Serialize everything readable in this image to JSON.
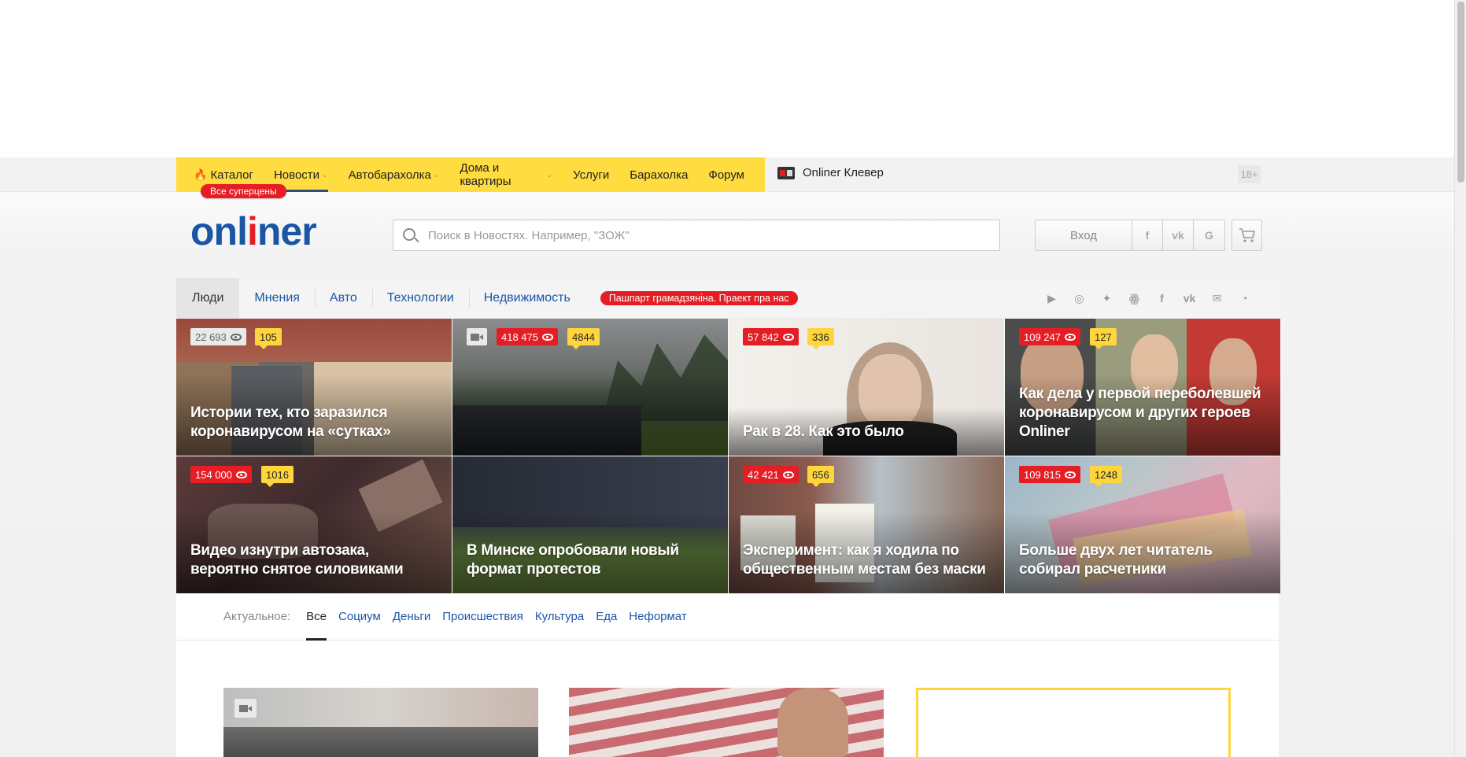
{
  "topnav": {
    "items": [
      {
        "label": "Каталог",
        "icon": "fire-icon",
        "caret": false,
        "active": false
      },
      {
        "label": "Новости",
        "caret": true,
        "active": true
      },
      {
        "label": "Автобарахолка",
        "caret": true,
        "active": false
      },
      {
        "label": "Дома и квартиры",
        "caret": true,
        "active": false
      },
      {
        "label": "Услуги",
        "caret": false,
        "active": false
      },
      {
        "label": "Барахолка",
        "caret": false,
        "active": false
      },
      {
        "label": "Форум",
        "caret": false,
        "active": false
      }
    ],
    "superprice_badge": "Все суперцены",
    "klever_label": "Onliner Клевер",
    "age_label": "18+"
  },
  "header": {
    "logo_part1": "onl",
    "logo_accent": "i",
    "logo_part2": "ner",
    "search_placeholder": "Поиск в Новостях. Например, \"ЗОЖ\"",
    "login_label": "Вход",
    "social_login": [
      "f",
      "vk",
      "G"
    ],
    "cart_icon": "cart-icon"
  },
  "sections": {
    "items": [
      "Люди",
      "Мнения",
      "Авто",
      "Технологии",
      "Недвижимость"
    ],
    "promo": "Пашпарт грамадзяніна. Праект пра нас",
    "socials": [
      "youtube-icon",
      "instagram-icon",
      "twitter-icon",
      "odnoklassniki-icon",
      "facebook-icon",
      "vk-icon",
      "mail-icon",
      "rss-icon"
    ]
  },
  "tiles": [
    {
      "views": "22 693",
      "comments": "105",
      "title": "Истории тех, кто заразился коронавирусом на «сутках»",
      "views_style": "gray",
      "video": false
    },
    {
      "views": "418 475",
      "comments": "4844",
      "title": "",
      "views_style": "red",
      "video": true
    },
    {
      "views": "57 842",
      "comments": "336",
      "title": "Рак в 28. Как это было",
      "views_style": "red",
      "video": false
    },
    {
      "views": "109 247",
      "comments": "127",
      "title": "Как дела у первой переболевшей коронавирусом и других героев Onliner",
      "views_style": "red",
      "video": false
    },
    {
      "views": "154 000",
      "comments": "1016",
      "title": "Видео изнутри автозака, вероятно снятое силовиками",
      "views_style": "red",
      "video": false
    },
    {
      "views": "",
      "comments": "",
      "title": "В Минске опробовали новый формат протестов",
      "views_style": "none",
      "video": false
    },
    {
      "views": "42 421",
      "comments": "656",
      "title": "Эксперимент: как я ходила по общественным местам без маски",
      "views_style": "red",
      "video": false
    },
    {
      "views": "109 815",
      "comments": "1248",
      "title": "Больше двух лет читатель собирал расчетники",
      "views_style": "red",
      "video": false
    }
  ],
  "actual": {
    "label": "Актуальное:",
    "tabs": [
      "Все",
      "Социум",
      "Деньги",
      "Происшествия",
      "Культура",
      "Еда",
      "Неформат"
    ],
    "active_index": 0
  },
  "colors": {
    "yellow": "#ffdc3f",
    "brand_blue": "#1a56a6",
    "accent_red": "#e51e25",
    "comment_yellow": "#ffd53d"
  }
}
